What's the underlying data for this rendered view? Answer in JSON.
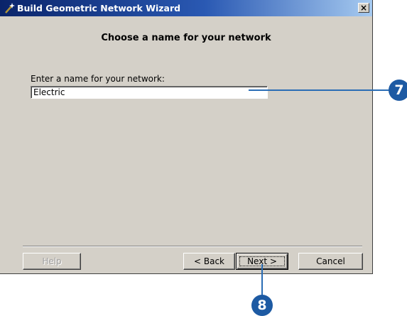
{
  "window": {
    "title": "Build Geometric Network Wizard",
    "close_glyph": "×"
  },
  "page": {
    "heading": "Choose a name for your network",
    "name_label": "Enter a name for your network:",
    "name_value": "Electric"
  },
  "buttons": {
    "help": "Help",
    "back": "< Back",
    "next": "Next >",
    "cancel": "Cancel"
  },
  "callouts": {
    "input": "7",
    "next": "8"
  },
  "colors": {
    "dialog_bg": "#d4d0c8",
    "titlebar_start": "#0a246a",
    "titlebar_end": "#a6caf0",
    "callout": "#1d5aa3"
  }
}
